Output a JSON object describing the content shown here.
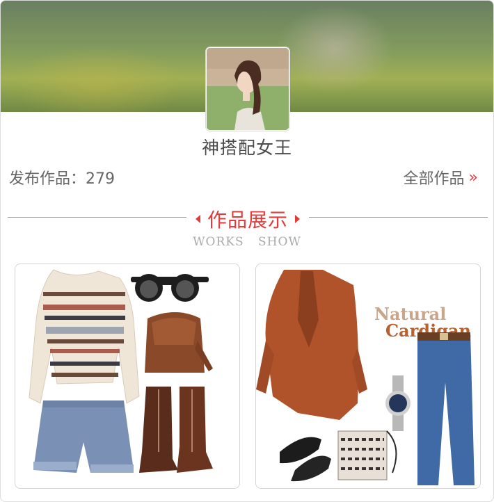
{
  "profile": {
    "name": "神搭配女王"
  },
  "stats": {
    "label": "发布作品：",
    "count": "279",
    "all_works_label": "全部作品",
    "all_works_arrow": "»"
  },
  "section": {
    "title": "作品展示",
    "subtitle": "WORKS SHOW"
  },
  "works": [
    {
      "name": "outfit-1"
    },
    {
      "name": "outfit-2",
      "caption_line1": "Natural",
      "caption_line2": "Cardigan"
    }
  ],
  "colors": {
    "accent": "#e23b3b",
    "text": "#555555",
    "border": "#d4d4d4"
  }
}
